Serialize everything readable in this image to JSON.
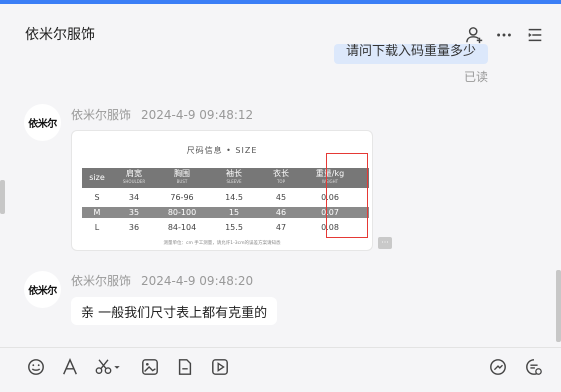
{
  "header": {
    "title": "依米尔服饰",
    "icons": [
      "add-person-icon",
      "more-icon",
      "list-icon"
    ]
  },
  "previous_message": {
    "text": "请问下载入码重量多少",
    "read_status": "已读"
  },
  "messages": [
    {
      "sender": "依米尔服饰",
      "time": "2024-4-9 09:48:12",
      "avatar_text": "依米尔",
      "type": "image",
      "image": {
        "title": "尺码信息 • SIZE",
        "headers": [
          {
            "cn": "size",
            "en": ""
          },
          {
            "cn": "肩宽",
            "en": "SHOULDER"
          },
          {
            "cn": "胸围",
            "en": "BUST"
          },
          {
            "cn": "袖长",
            "en": "SLEEVE"
          },
          {
            "cn": "衣长",
            "en": "TOP"
          },
          {
            "cn": "重量/kg",
            "en": "WEIGHT"
          }
        ],
        "rows": [
          [
            "S",
            "34",
            "76-96",
            "14.5",
            "45",
            "0.06"
          ],
          [
            "M",
            "35",
            "80-100",
            "15",
            "46",
            "0.07"
          ],
          [
            "L",
            "36",
            "84-104",
            "15.5",
            "47",
            "0.08"
          ]
        ],
        "footnote": "测量单位：cm  手工测量，请允许1-3cm的误差方案请知悉",
        "highlight_color": "#e53935"
      },
      "more_label": "···"
    },
    {
      "sender": "依米尔服饰",
      "time": "2024-4-9 09:48:20",
      "avatar_text": "依米尔",
      "type": "text",
      "text": "亲 一般我们尺寸表上都有克重的"
    }
  ],
  "toolbar": {
    "left_icons": [
      "emoji-icon",
      "font-icon",
      "scissors-icon",
      "image-icon",
      "file-icon",
      "video-icon"
    ],
    "right_icons": [
      "quick-reply-icon",
      "chat-record-icon"
    ]
  },
  "colors": {
    "accent": "#3b7ef6",
    "bubble_self": "#dce8fb",
    "background": "#f5f5f7"
  }
}
